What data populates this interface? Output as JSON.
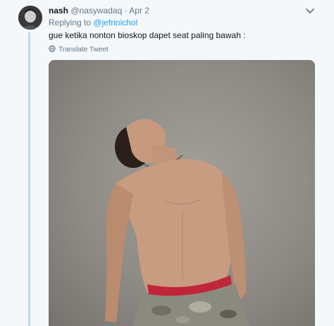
{
  "tweet": {
    "author_name": "nash",
    "author_handle": "@nasywadaq",
    "separator": "·",
    "date": "Apr 2",
    "replying_prefix": "Replying to",
    "replying_to": "@jefrinichol",
    "text": "gue ketika nonton bioskop dapet seat paling bawah :",
    "translate_label": "Translate Tweet"
  },
  "icons": {
    "menu": "chevron-down-icon",
    "translate": "globe-icon"
  },
  "colors": {
    "background": "#f5f8fa",
    "link": "#1da1f2",
    "muted": "#657786",
    "thread_line": "#b3dcf2"
  }
}
